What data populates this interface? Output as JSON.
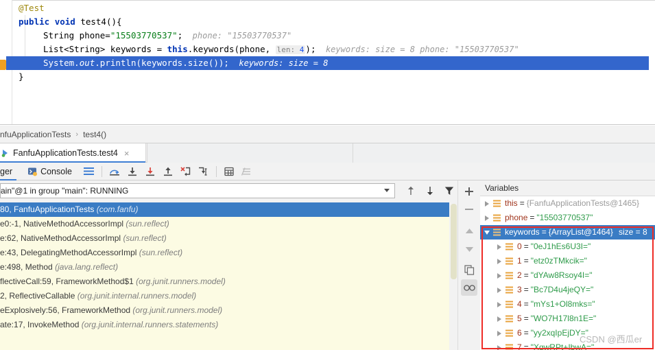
{
  "editor": {
    "lines": [
      {
        "indent": 1,
        "tokens": [
          {
            "t": "ann",
            "v": "@Test"
          }
        ]
      },
      {
        "indent": 1,
        "tokens": [
          {
            "t": "kw",
            "v": "public"
          },
          {
            "t": "sp",
            "v": " "
          },
          {
            "t": "kw",
            "v": "void"
          },
          {
            "t": "sp",
            "v": " "
          },
          {
            "t": "fn",
            "v": "test4"
          },
          {
            "t": "plain",
            "v": "(){"
          }
        ]
      },
      {
        "indent": 2,
        "tokens": [
          {
            "t": "plain",
            "v": "String phone="
          },
          {
            "t": "str",
            "v": "\"15503770537\""
          },
          {
            "t": "plain",
            "v": ";"
          }
        ],
        "hints": "phone:  \"15503770537\""
      },
      {
        "indent": 2,
        "tokens": [
          {
            "t": "plain",
            "v": "List<String> keywords = "
          },
          {
            "t": "kw",
            "v": "this"
          },
          {
            "t": "plain",
            "v": ".keywords(phone, "
          }
        ],
        "chip": {
          "label": "len:",
          "value": "4"
        },
        "after_chip": ");",
        "hints": "keywords:  size = 8  phone: \"15503770537\""
      },
      {
        "indent": 2,
        "highlighted": true,
        "tokens": [
          {
            "t": "plain",
            "v": "System."
          },
          {
            "t": "ital",
            "v": "out"
          },
          {
            "t": "plain",
            "v": ".println(keywords.size());"
          }
        ],
        "hints": "keywords:  size = 8"
      },
      {
        "indent": 1,
        "tokens": [
          {
            "t": "plain",
            "v": "}"
          }
        ]
      }
    ]
  },
  "breadcrumb": {
    "class_name": "nfuApplicationTests",
    "separator": "›",
    "method_name": "test4()"
  },
  "run_tab": {
    "label": "FanfuApplicationTests.test4",
    "close_label": "×"
  },
  "debug_toolbar": {
    "debugger_tab_label": "ger",
    "console_tab_label": "Console",
    "buttons": [
      "layout-settings-icon",
      "step-over-icon",
      "step-into-icon",
      "force-step-into-icon",
      "step-out-icon",
      "drop-frame-icon",
      "run-to-cursor-icon",
      "evaluate-expression-icon",
      "mute-breakpoints-icon"
    ]
  },
  "threads": {
    "selected": "ain\"@1 in group \"main\": RUNNING",
    "nav_up_label": "↑",
    "nav_down_label": "↓",
    "filter_label": "filter-icon"
  },
  "frames": [
    {
      "text": "80, FanfuApplicationTests",
      "pkg": "(com.fanfu)",
      "selected": true
    },
    {
      "text": "e0:-1, NativeMethodAccessorImpl",
      "pkg": "(sun.reflect)",
      "selected": false
    },
    {
      "text": "e:62, NativeMethodAccessorImpl",
      "pkg": "(sun.reflect)",
      "selected": false
    },
    {
      "text": "e:43, DelegatingMethodAccessorImpl",
      "pkg": "(sun.reflect)",
      "selected": false
    },
    {
      "text": "e:498, Method",
      "pkg": "(java.lang.reflect)",
      "selected": false
    },
    {
      "text": "flectiveCall:59, FrameworkMethod$1",
      "pkg": "(org.junit.runners.model)",
      "selected": false
    },
    {
      "text": "2, ReflectiveCallable",
      "pkg": "(org.junit.internal.runners.model)",
      "selected": false
    },
    {
      "text": "eExplosively:56, FrameworkMethod",
      "pkg": "(org.junit.runners.model)",
      "selected": false
    },
    {
      "text": "ate:17, InvokeMethod",
      "pkg": "(org.junit.internal.runners.statements)",
      "selected": false
    }
  ],
  "side_tools": [
    "add-watch-icon",
    "remove-watch-icon",
    "move-up-icon",
    "move-down-icon",
    "copy-value-icon",
    "inspect-icon"
  ],
  "variables": {
    "title": "Variables",
    "rows": [
      {
        "depth": 0,
        "expanded": false,
        "name": "this",
        "eq": "=",
        "value": "{FanfuApplicationTests@1465}",
        "kind": "object",
        "selected": false
      },
      {
        "depth": 0,
        "expanded": false,
        "name": "phone",
        "eq": "=",
        "value": "\"15503770537\"",
        "kind": "string",
        "selected": false
      },
      {
        "depth": 0,
        "expanded": true,
        "name": "keywords",
        "eq": "=",
        "value": "{ArrayList@1464}",
        "size": "size = 8",
        "kind": "object",
        "selected": true
      },
      {
        "depth": 1,
        "expanded": false,
        "name": "0",
        "eq": "=",
        "value": "\"0eJ1hEs6U3I=\"",
        "kind": "string",
        "selected": false
      },
      {
        "depth": 1,
        "expanded": false,
        "name": "1",
        "eq": "=",
        "value": "\"etz0zTMkcik=\"",
        "kind": "string",
        "selected": false
      },
      {
        "depth": 1,
        "expanded": false,
        "name": "2",
        "eq": "=",
        "value": "\"dYAw8Rsoy4I=\"",
        "kind": "string",
        "selected": false
      },
      {
        "depth": 1,
        "expanded": false,
        "name": "3",
        "eq": "=",
        "value": "\"Bc7D4u4jeQY=\"",
        "kind": "string",
        "selected": false
      },
      {
        "depth": 1,
        "expanded": false,
        "name": "4",
        "eq": "=",
        "value": "\"mYs1+Ol8mks=\"",
        "kind": "string",
        "selected": false
      },
      {
        "depth": 1,
        "expanded": false,
        "name": "5",
        "eq": "=",
        "value": "\"WO7H17l8n1E=\"",
        "kind": "string",
        "selected": false
      },
      {
        "depth": 1,
        "expanded": false,
        "name": "6",
        "eq": "=",
        "value": "\"yy2xqIpEjDY=\"",
        "kind": "string",
        "selected": false
      },
      {
        "depth": 1,
        "expanded": false,
        "name": "7",
        "eq": "=",
        "value": "\"XqwRPt+IbwA=\"",
        "kind": "string",
        "selected": false
      }
    ]
  },
  "watermark": "CSDN @西瓜er",
  "colors": {
    "selection_blue": "#3a7cc4",
    "code_selection": "#3366cc",
    "frames_bg": "#fcfbe3",
    "annotation_red": "#ee2b25",
    "string_green": "#067d17",
    "keyword_blue": "#0033b3",
    "var_name_red": "#a0351d",
    "var_string_green": "#2e9b4a"
  }
}
